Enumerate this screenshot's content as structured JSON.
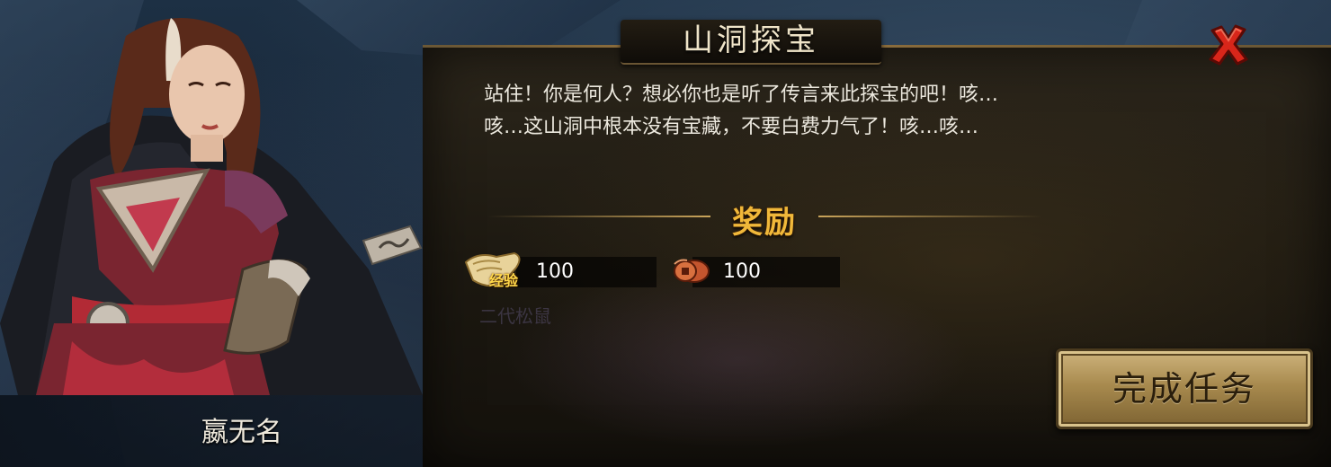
{
  "window": {
    "title": "山洞探宝"
  },
  "dialog": {
    "lines": [
      "站住！你是何人？想必你也是听了传言来此探宝的吧！咳…",
      "咳…这山洞中根本没有宝藏，不要白费力气了！咳…咳…"
    ]
  },
  "rewards": {
    "title": "奖励",
    "exp": {
      "icon": "scroll-icon",
      "label": "经验",
      "value": "100"
    },
    "coin": {
      "icon": "coin-string-icon",
      "value": "100"
    }
  },
  "background_text": "二代松鼠",
  "npc": {
    "name": "嬴无名",
    "icon": "npc-portrait"
  },
  "buttons": {
    "complete": "完成任务",
    "close_icon": "close-x-icon"
  },
  "colors": {
    "accent_gold": "#f0b83a",
    "close_red": "#d8261a",
    "button_gold": "#a88a4e"
  }
}
